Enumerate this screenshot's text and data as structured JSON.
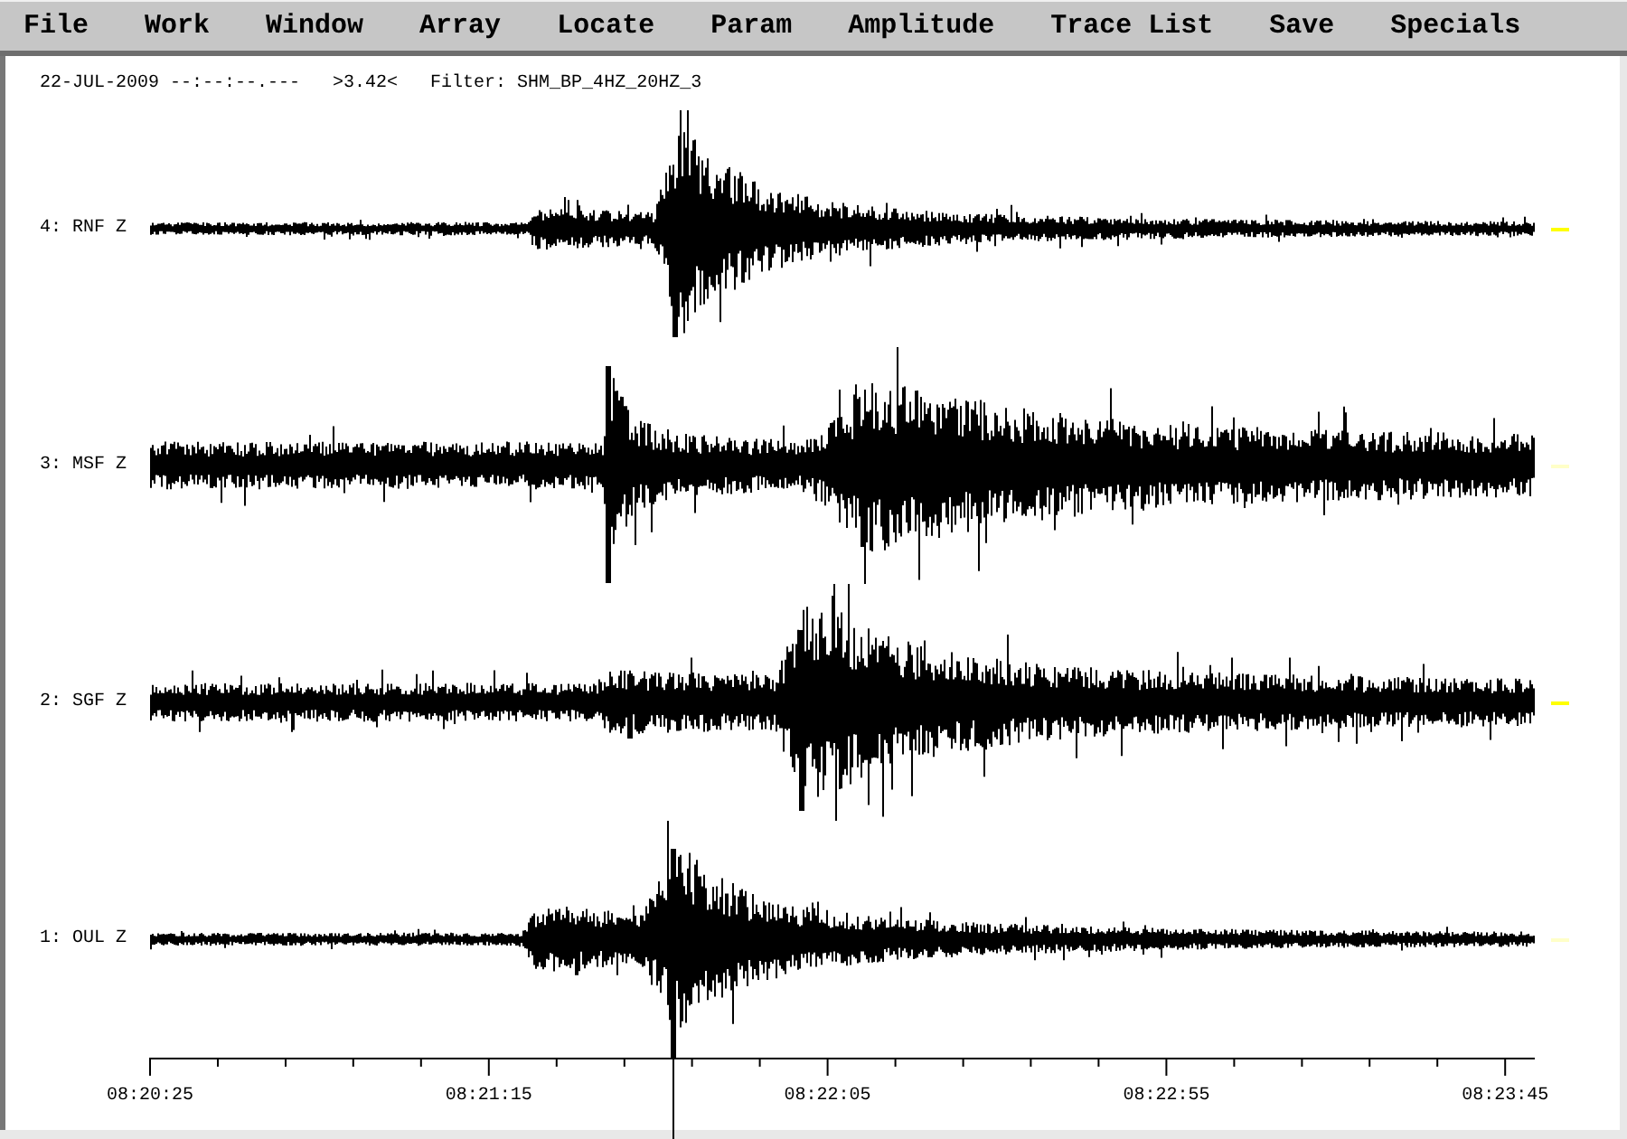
{
  "menu_bar": {
    "items": [
      {
        "label": "File"
      },
      {
        "label": "Work"
      },
      {
        "label": "Window"
      },
      {
        "label": "Array"
      },
      {
        "label": "Locate"
      },
      {
        "label": "Param"
      },
      {
        "label": "Amplitude"
      },
      {
        "label": "Trace List"
      },
      {
        "label": "Save"
      },
      {
        "label": "Specials"
      }
    ]
  },
  "header": {
    "date_time": "22-JUL-2009 --:--:--.---",
    "value": ">3.42<",
    "filter": "Filter: SHM_BP_4HZ_20HZ_3"
  },
  "traces": [
    {
      "label": "4: RNF Z",
      "color": "#ffff00"
    },
    {
      "label": "3: MSF Z",
      "color": "#ffffc8"
    },
    {
      "label": "2: SGF Z",
      "color": "#ffff00"
    },
    {
      "label": "1: OUL Z",
      "color": "#ffffc8"
    }
  ],
  "time_axis": {
    "labels": [
      "08:20:25",
      "08:21:15",
      "08:22:05",
      "08:22:55",
      "08:23:45"
    ]
  }
}
